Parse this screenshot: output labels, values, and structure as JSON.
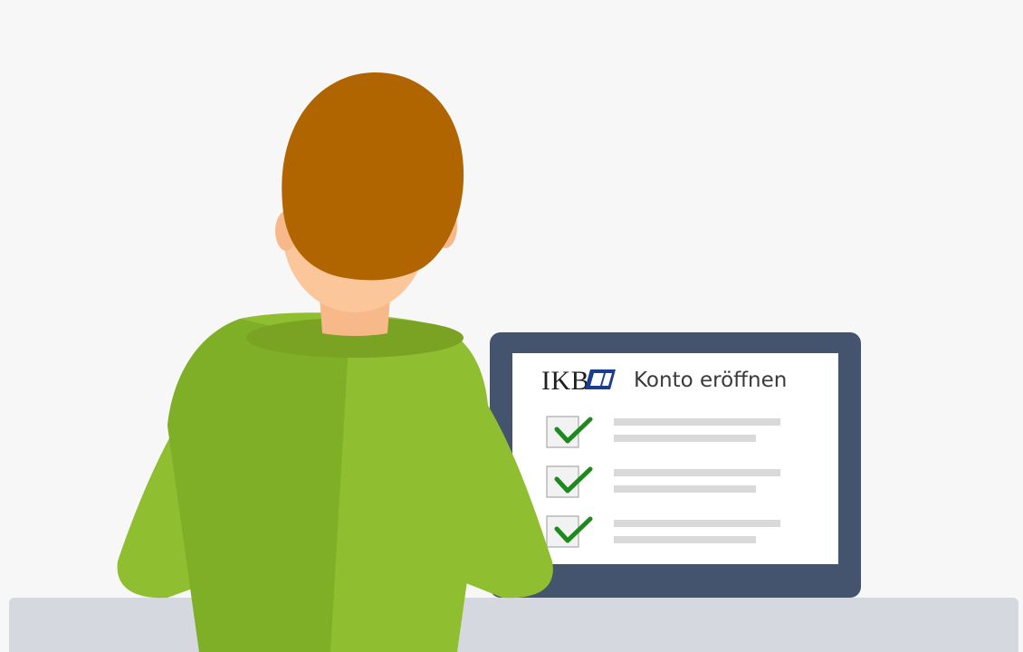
{
  "screen": {
    "logo_text": "IKB",
    "title": "Konto eröffnen",
    "checklist": [
      {
        "checked": true
      },
      {
        "checked": true
      },
      {
        "checked": true
      }
    ]
  },
  "colors": {
    "background": "#f7f7f7",
    "desk": "#d5d8df",
    "laptop_frame": "#44546f",
    "screen": "#ffffff",
    "placeholder_line": "#d9d9d9",
    "check_green": "#1e8a1e",
    "logo_blue": "#1a3d8f",
    "hair": "#b06500",
    "skin": "#fbc79a",
    "shirt_light": "#8fbe31",
    "shirt_dark": "#7fae27"
  },
  "icons": {
    "logo_mark": "ikb-logo-icon",
    "checkbox": "checkbox-checked-icon"
  }
}
